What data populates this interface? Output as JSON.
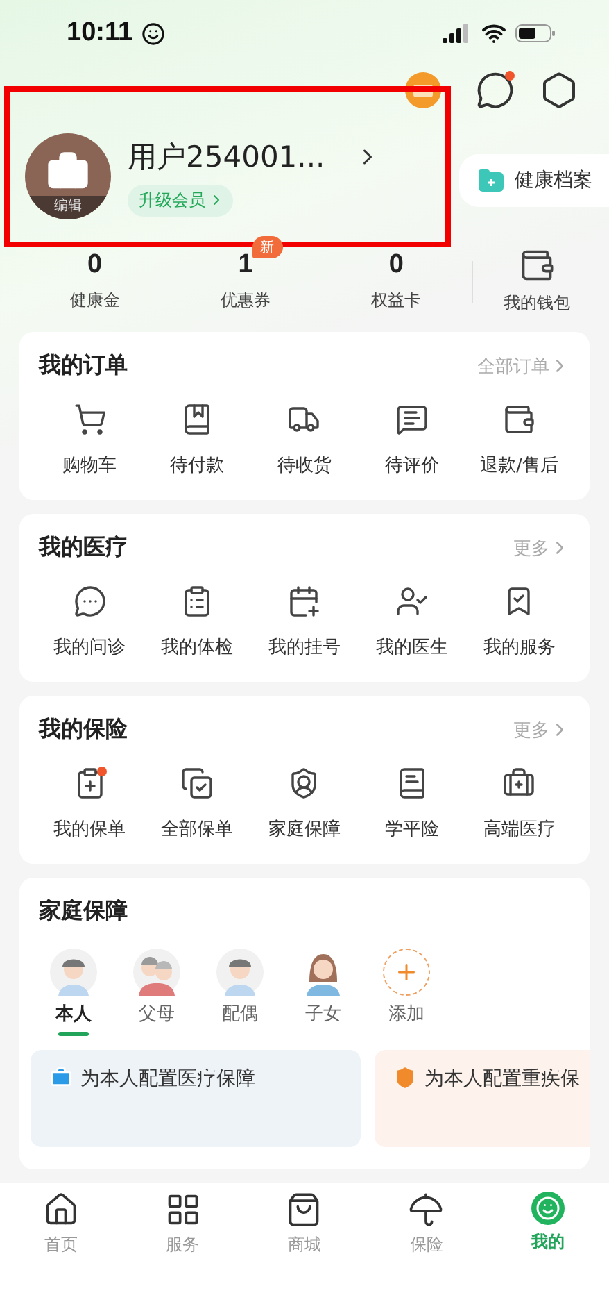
{
  "status_bar": {
    "time": "10:11"
  },
  "header": {
    "message_unread": true
  },
  "profile": {
    "name": "用户254001...",
    "edit_label": "编辑",
    "member_badge": "升级会员",
    "highlighted": true
  },
  "health_record": {
    "label": "健康档案"
  },
  "stats": [
    {
      "value": "0",
      "label": "健康金"
    },
    {
      "value": "1",
      "label": "优惠券",
      "badge": "新"
    },
    {
      "value": "0",
      "label": "权益卡"
    }
  ],
  "wallet": {
    "label": "我的钱包"
  },
  "sections": [
    {
      "title": "我的订单",
      "link": "全部订单",
      "items": [
        {
          "label": "购物车",
          "dot": false
        },
        {
          "label": "待付款",
          "dot": false
        },
        {
          "label": "待收货",
          "dot": false
        },
        {
          "label": "待评价",
          "dot": false
        },
        {
          "label": "退款/售后",
          "dot": false
        }
      ]
    },
    {
      "title": "我的医疗",
      "link": "更多",
      "items": [
        {
          "label": "我的问诊",
          "dot": false
        },
        {
          "label": "我的体检",
          "dot": false
        },
        {
          "label": "我的挂号",
          "dot": false
        },
        {
          "label": "我的医生",
          "dot": false
        },
        {
          "label": "我的服务",
          "dot": false
        }
      ]
    },
    {
      "title": "我的保险",
      "link": "更多",
      "items": [
        {
          "label": "我的保单",
          "dot": true
        },
        {
          "label": "全部保单",
          "dot": false
        },
        {
          "label": "家庭保障",
          "dot": false
        },
        {
          "label": "学平险",
          "dot": false
        },
        {
          "label": "高端医疗",
          "dot": false
        }
      ]
    }
  ],
  "family": {
    "title": "家庭保障",
    "members": [
      {
        "label": "本人",
        "kind": "person",
        "selected": true
      },
      {
        "label": "父母",
        "kind": "parents",
        "selected": false
      },
      {
        "label": "配偶",
        "kind": "person",
        "selected": false
      },
      {
        "label": "子女",
        "kind": "woman",
        "selected": false
      },
      {
        "label": "添加",
        "kind": "add",
        "selected": false
      }
    ]
  },
  "plans": [
    {
      "title": "为本人配置医疗保障",
      "kind": "medical"
    },
    {
      "title": "为本人配置重疾保",
      "kind": "critical"
    }
  ],
  "nav": [
    {
      "label": "首页",
      "selected": false
    },
    {
      "label": "服务",
      "selected": false
    },
    {
      "label": "商城",
      "selected": false
    },
    {
      "label": "保险",
      "selected": false
    },
    {
      "label": "我的",
      "selected": true
    }
  ]
}
